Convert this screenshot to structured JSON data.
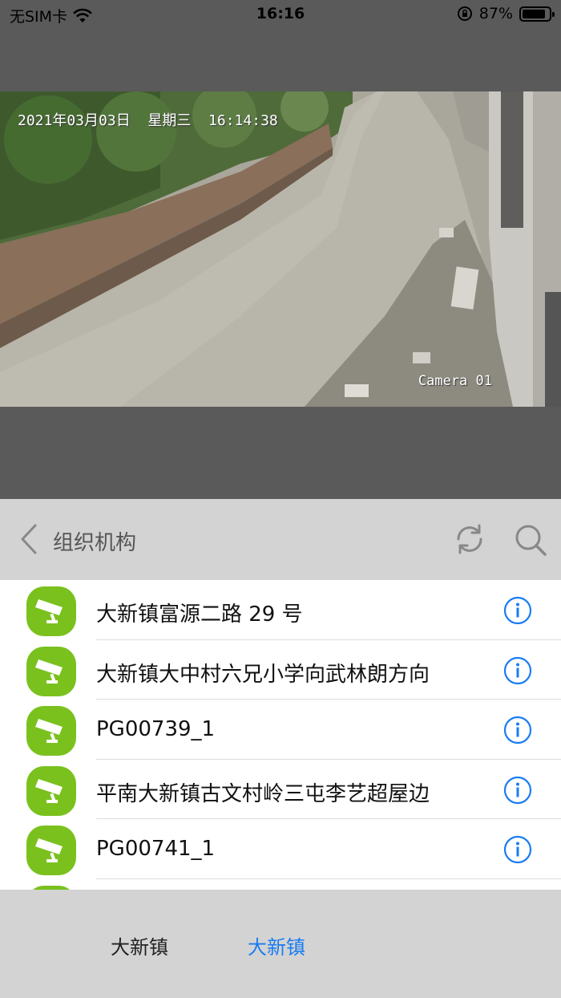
{
  "status_bar": {
    "carrier": "无SIM卡",
    "time": "16:16",
    "battery_percent": "87%",
    "battery_level": 0.87
  },
  "video": {
    "osd_datetime": "2021年03月03日  星期三  16:14:38",
    "osd_camera": "Camera 01"
  },
  "header": {
    "title": "组织机构"
  },
  "list": {
    "items": [
      {
        "label": "大新镇富源二路 29 号"
      },
      {
        "label": "大新镇大中村六兄小学向武林朗方向"
      },
      {
        "label": "PG00739_1"
      },
      {
        "label": "平南大新镇古文村岭三屯李艺超屋边"
      },
      {
        "label": "PG00741_1"
      }
    ]
  },
  "breadcrumbs": {
    "first": "大新镇",
    "second": "大新镇"
  },
  "colors": {
    "accent": "#1a7cf2",
    "camera_avatar": "#7ac11e"
  }
}
